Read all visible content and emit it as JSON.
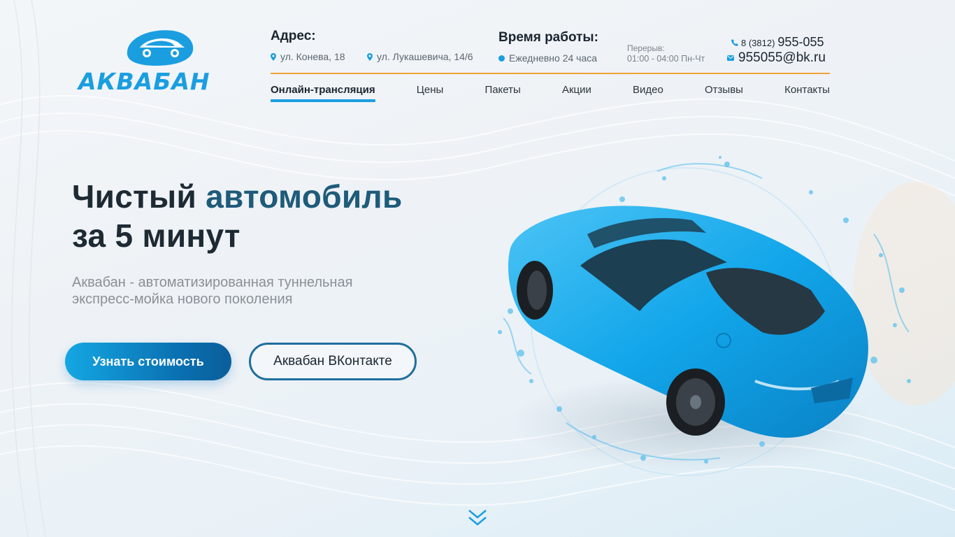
{
  "logo": {
    "text": "АКВАБАН"
  },
  "header": {
    "address_title": "Адрес:",
    "addresses": [
      "ул. Конева, 18",
      "ул. Лукашевича, 14/6"
    ],
    "hours_title": "Время работы:",
    "hours": "Ежедневно 24 часа",
    "break_label": "Перерыв:",
    "break_value": "01:00 - 04:00 Пн-Чт",
    "phone_code": "8 (3812)",
    "phone_number": "955-055",
    "email": "955055@bk.ru"
  },
  "nav": {
    "items": [
      {
        "label": "Онлайн-трансляция",
        "active": true
      },
      {
        "label": "Цены"
      },
      {
        "label": "Пакеты"
      },
      {
        "label": "Акции"
      },
      {
        "label": "Видео"
      },
      {
        "label": "Отзывы"
      },
      {
        "label": "Контакты"
      }
    ]
  },
  "hero": {
    "title_line1_a": "Чистый ",
    "title_line1_b": "автомобиль",
    "title_line2": "за 5 минут",
    "subtitle": "Аквабан - автоматизированная туннельная экспресс-мойка нового поколения",
    "primary_button": "Узнать стоимость",
    "secondary_button": "Аквабан ВКонтакте"
  },
  "colors": {
    "brand_blue": "#1a9ee0",
    "accent_orange": "#f0a13a",
    "title_accent": "#1f5b7a"
  },
  "icons": [
    "map-pin-icon",
    "clock-icon",
    "phone-icon",
    "mail-icon",
    "chevron-down-icon"
  ]
}
